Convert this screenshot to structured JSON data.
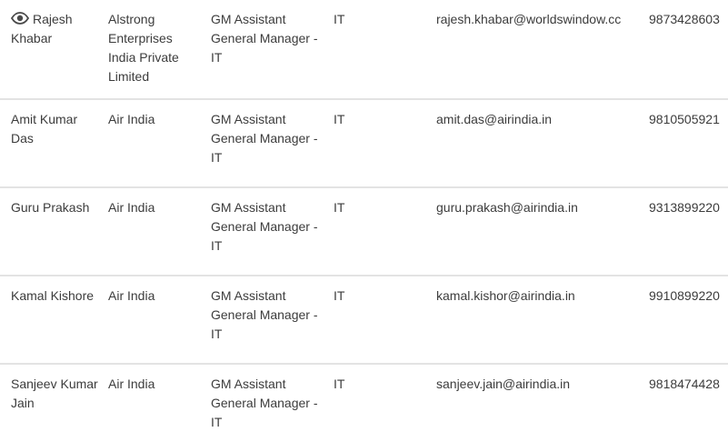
{
  "contacts": [
    {
      "name": "Rajesh Khabar",
      "organization": "Alstrong Enterprises India Private Limited",
      "designation": "GM Assistant General Manager - IT",
      "department": "IT",
      "email": "rajesh.khabar@worldswindow.cc",
      "phone": "9873428603",
      "icon": "eye-icon"
    },
    {
      "name": "Amit Kumar Das",
      "organization": "Air India",
      "designation": "GM Assistant General Manager - IT",
      "department": "IT",
      "email": "amit.das@airindia.in",
      "phone": "9810505921"
    },
    {
      "name": "Guru Prakash",
      "organization": "Air India",
      "designation": "GM Assistant General Manager - IT",
      "department": "IT",
      "email": "guru.prakash@airindia.in",
      "phone": "9313899220"
    },
    {
      "name": "Kamal Kishore",
      "organization": "Air India",
      "designation": "GM Assistant General Manager - IT",
      "department": "IT",
      "email": "kamal.kishor@airindia.in",
      "phone": "9910899220"
    },
    {
      "name": "Sanjeev Kumar Jain",
      "organization": "Air India",
      "designation": "GM Assistant General Manager - IT",
      "department": "IT",
      "email": "sanjeev.jain@airindia.in",
      "phone": "9818474428"
    }
  ],
  "colors": {
    "text": "#3c3c3c",
    "divider": "#e3e3e3",
    "background": "#ffffff"
  }
}
